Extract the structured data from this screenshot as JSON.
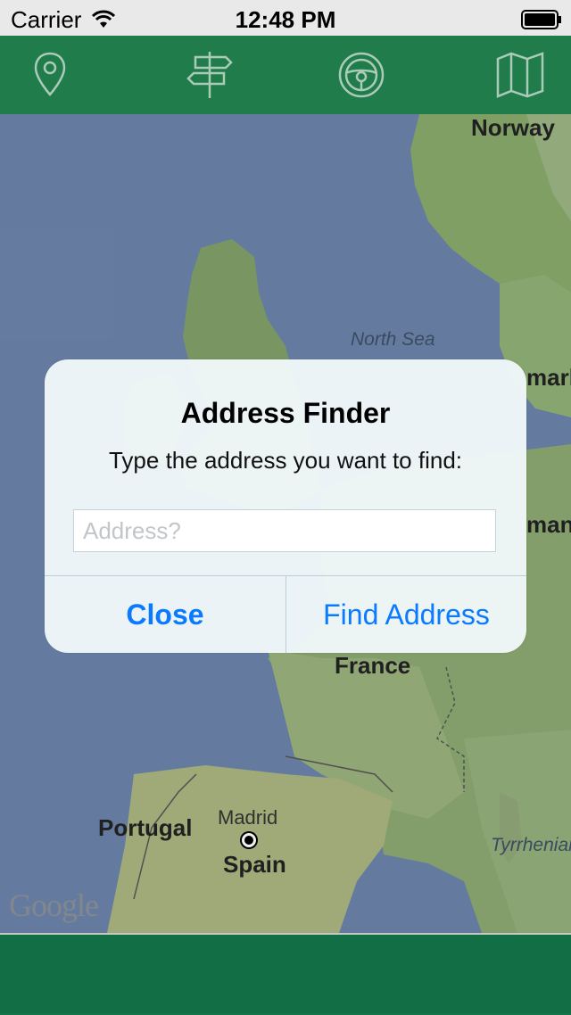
{
  "status_bar": {
    "carrier": "Carrier",
    "time": "12:48 PM"
  },
  "toolbar": {
    "icons": [
      "map-pin-icon",
      "signpost-icon",
      "steering-wheel-icon",
      "map-icon"
    ],
    "color": "#22834f"
  },
  "map": {
    "labels": {
      "norway": "Norway",
      "north_sea": "North Sea",
      "denmark_partial": "mark",
      "germany_partial": "man",
      "france": "France",
      "portugal": "Portugal",
      "madrid": "Madrid",
      "spain": "Spain",
      "tyrrhenian_partial": "Tyrrhenian"
    },
    "attribution": "Google"
  },
  "dialog": {
    "title": "Address Finder",
    "message": "Type the address you want to find:",
    "input_placeholder": "Address?",
    "input_value": "",
    "close_label": "Close",
    "find_label": "Find Address",
    "accent_color": "#0a7aff"
  },
  "bottom_bar": {
    "color": "#137549"
  }
}
